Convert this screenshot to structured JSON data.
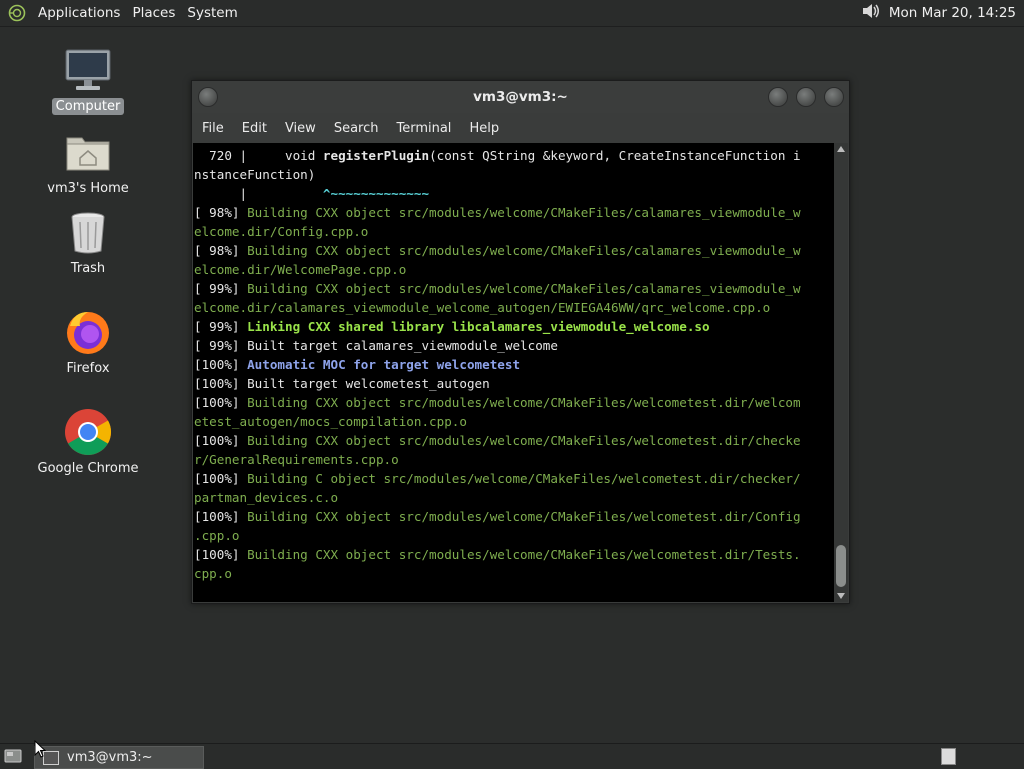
{
  "top_panel": {
    "menus": [
      "Applications",
      "Places",
      "System"
    ],
    "clock": "Mon Mar 20, 14:25"
  },
  "desktop": {
    "icons": [
      {
        "label": "Computer",
        "icon": "computer-icon",
        "selected": true
      },
      {
        "label": "vm3's Home",
        "icon": "home-folder-icon"
      },
      {
        "label": "Trash",
        "icon": "trash-icon"
      },
      {
        "label": "Firefox",
        "icon": "firefox-icon"
      },
      {
        "label": "Google Chrome",
        "icon": "chrome-icon"
      }
    ]
  },
  "terminal": {
    "title": "vm3@vm3:~",
    "menu": [
      "File",
      "Edit",
      "View",
      "Search",
      "Terminal",
      "Help"
    ],
    "lines": [
      [
        {
          "t": "  720 |     void "
        },
        {
          "t": "registerPlugin",
          "c": "c-bold"
        },
        {
          "t": "(const QString &keyword, CreateInstanceFunction i"
        }
      ],
      [
        {
          "t": "nstanceFunction)"
        }
      ],
      [
        {
          "t": "      |          "
        },
        {
          "t": "^~~~~~~~~~~~~~",
          "c": "c-cyan"
        }
      ],
      [
        {
          "t": "[ 98%] "
        },
        {
          "t": "Building CXX object src/modules/welcome/CMakeFiles/calamares_viewmodule_w",
          "c": "c-green"
        }
      ],
      [
        {
          "t": "elcome.dir/Config.cpp.o",
          "c": "c-green"
        }
      ],
      [
        {
          "t": "[ 98%] "
        },
        {
          "t": "Building CXX object src/modules/welcome/CMakeFiles/calamares_viewmodule_w",
          "c": "c-green"
        }
      ],
      [
        {
          "t": "elcome.dir/WelcomePage.cpp.o",
          "c": "c-green"
        }
      ],
      [
        {
          "t": "[ 99%] "
        },
        {
          "t": "Building CXX object src/modules/welcome/CMakeFiles/calamares_viewmodule_w",
          "c": "c-green"
        }
      ],
      [
        {
          "t": "elcome.dir/calamares_viewmodule_welcome_autogen/EWIEGA46WW/qrc_welcome.cpp.o",
          "c": "c-green"
        }
      ],
      [
        {
          "t": "[ 99%] "
        },
        {
          "t": "Linking CXX shared library libcalamares_viewmodule_welcome.so",
          "c": "c-bgreen"
        }
      ],
      [
        {
          "t": "[ 99%] Built target calamares_viewmodule_welcome"
        }
      ],
      [
        {
          "t": "[100%] "
        },
        {
          "t": "Automatic MOC for target welcometest",
          "c": "c-blue"
        }
      ],
      [
        {
          "t": "[100%] Built target welcometest_autogen"
        }
      ],
      [
        {
          "t": "[100%] "
        },
        {
          "t": "Building CXX object src/modules/welcome/CMakeFiles/welcometest.dir/welcom",
          "c": "c-green"
        }
      ],
      [
        {
          "t": "etest_autogen/mocs_compilation.cpp.o",
          "c": "c-green"
        }
      ],
      [
        {
          "t": "[100%] "
        },
        {
          "t": "Building CXX object src/modules/welcome/CMakeFiles/welcometest.dir/checke",
          "c": "c-green"
        }
      ],
      [
        {
          "t": "r/GeneralRequirements.cpp.o",
          "c": "c-green"
        }
      ],
      [
        {
          "t": "[100%] "
        },
        {
          "t": "Building C object src/modules/welcome/CMakeFiles/welcometest.dir/checker/",
          "c": "c-green"
        }
      ],
      [
        {
          "t": "partman_devices.c.o",
          "c": "c-green"
        }
      ],
      [
        {
          "t": "[100%] "
        },
        {
          "t": "Building CXX object src/modules/welcome/CMakeFiles/welcometest.dir/Config",
          "c": "c-green"
        }
      ],
      [
        {
          "t": ".cpp.o",
          "c": "c-green"
        }
      ],
      [
        {
          "t": "[100%] "
        },
        {
          "t": "Building CXX object src/modules/welcome/CMakeFiles/welcometest.dir/Tests.",
          "c": "c-green"
        }
      ],
      [
        {
          "t": "cpp.o",
          "c": "c-green"
        }
      ]
    ]
  },
  "taskbar": {
    "task_label": "vm3@vm3:~"
  }
}
